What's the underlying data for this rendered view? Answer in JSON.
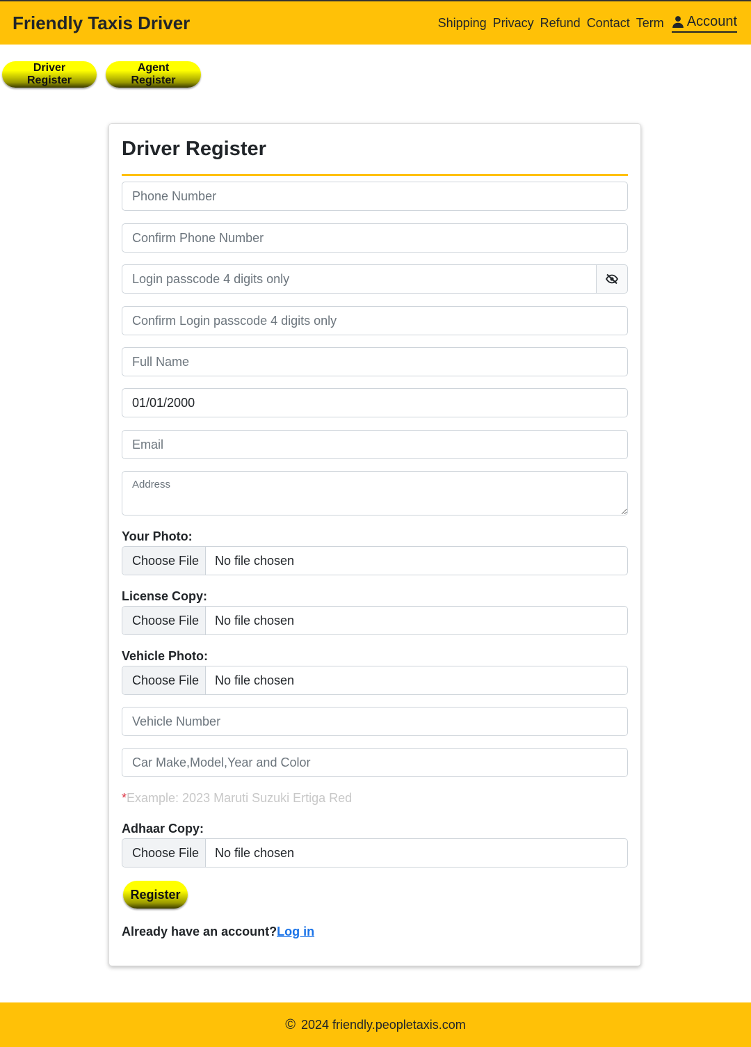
{
  "header": {
    "brand": "Friendly Taxis Driver",
    "nav": [
      "Shipping",
      "Privacy",
      "Refund",
      "Contact",
      "Term"
    ],
    "account_label": "Account"
  },
  "tabs": {
    "driver": "Driver Register",
    "agent": "Agent Register"
  },
  "form": {
    "title": "Driver Register",
    "phone_placeholder": "Phone Number",
    "confirm_phone_placeholder": "Confirm Phone Number",
    "passcode_placeholder": "Login passcode 4 digits only",
    "confirm_passcode_placeholder": "Confirm Login passcode 4 digits only",
    "fullname_placeholder": "Full Name",
    "dob_value": "01/01/2000",
    "email_placeholder": "Email",
    "address_placeholder": "Address",
    "photo_label": "Your Photo:",
    "license_label": "License Copy:",
    "vehicle_photo_label": "Vehicle Photo:",
    "choose_file": "Choose File",
    "no_file": "No file chosen",
    "vehicle_number_placeholder": "Vehicle Number",
    "car_details_placeholder": "Car Make,Model,Year and Color",
    "example_star": "*",
    "example_text": "Example: 2023 Maruti Suzuki Ertiga Red",
    "adhaar_label": "Adhaar Copy:",
    "register_button": "Register",
    "already_text": "Already have an account?",
    "login_link": "Log in"
  },
  "footer": {
    "copyright_symbol": "©",
    "text": "2024 friendly.peopletaxis.com"
  },
  "colors": {
    "brand_yellow": "#ffc107",
    "link_blue": "#1a73e8"
  }
}
